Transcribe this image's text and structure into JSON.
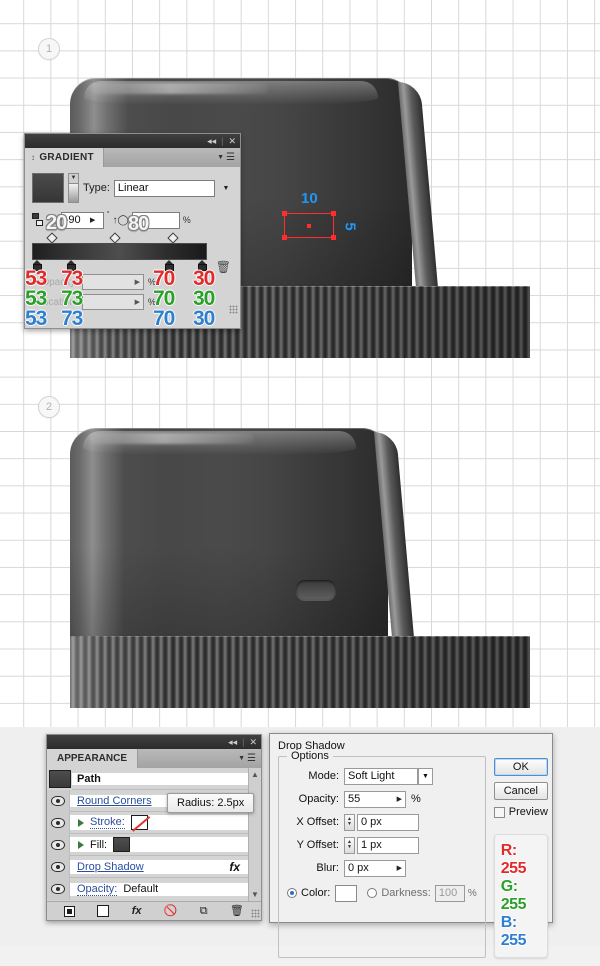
{
  "steps": [
    {
      "number": "1"
    },
    {
      "number": "2"
    }
  ],
  "measure": {
    "width_label": "10",
    "height_label": "5",
    "accent": "#2196f3",
    "rect_color": "#ff2d2d"
  },
  "gradient_panel": {
    "title": "GRADIENT",
    "close_icon": "close-icon",
    "collapse_icon": "collapse-icon",
    "menu_icon": "panel-menu-icon",
    "type_label": "Type:",
    "type_value": "Linear",
    "angle_value": "-90",
    "degree_symbol": "°",
    "aspect_value": "",
    "percent_symbol": "%",
    "opacity_label": "Opacity:",
    "opacity_value": "",
    "location_label": "Location:",
    "location_value": "",
    "overlay_angle": "20",
    "overlay_aspect": "80",
    "stop_columns": [
      {
        "r": "53",
        "g": "53",
        "b": "53"
      },
      {
        "r": "73",
        "g": "73",
        "b": "73"
      },
      {
        "r": "70",
        "g": "70",
        "b": "70"
      },
      {
        "r": "30",
        "g": "30",
        "b": "30"
      }
    ]
  },
  "appearance_panel": {
    "title": "APPEARANCE",
    "rows": [
      {
        "name": "Path",
        "type": "head"
      },
      {
        "name": "Round Corners",
        "type": "effect"
      },
      {
        "name": "Stroke:",
        "type": "stroke"
      },
      {
        "name": "Fill:",
        "type": "fill"
      },
      {
        "name": "Drop Shadow",
        "type": "effect-fx",
        "fx": "fx"
      },
      {
        "name": "Opacity:",
        "type": "opacity",
        "value": "Default"
      }
    ],
    "tooltip": "Radius: 2.5px",
    "footer_icons": [
      "add-new-stroke-icon",
      "add-new-fill-icon",
      "add-new-effect-icon",
      "clear-appearance-icon",
      "duplicate-item-icon",
      "delete-item-icon"
    ]
  },
  "drop_shadow_dialog": {
    "title": "Drop Shadow",
    "options_legend": "Options",
    "fields": [
      {
        "label": "Mode:",
        "value": "Soft Light",
        "kind": "select"
      },
      {
        "label": "Opacity:",
        "value": "55",
        "kind": "stepper-right",
        "suffix": "%"
      },
      {
        "label": "X Offset:",
        "value": "0 px",
        "kind": "spinner"
      },
      {
        "label": "Y Offset:",
        "value": "1 px",
        "kind": "spinner"
      },
      {
        "label": "Blur:",
        "value": "0 px",
        "kind": "stepper-right"
      }
    ],
    "color_label": "Color:",
    "color_value": "#ffffff",
    "color_selected": true,
    "darkness_label": "Darkness:",
    "darkness_value": "100",
    "darkness_suffix": "%",
    "ok_label": "OK",
    "cancel_label": "Cancel",
    "preview_label": "Preview",
    "preview_checked": false,
    "rgb_card": {
      "r": "R: 255",
      "g": "G: 255",
      "b": "B: 255"
    }
  }
}
